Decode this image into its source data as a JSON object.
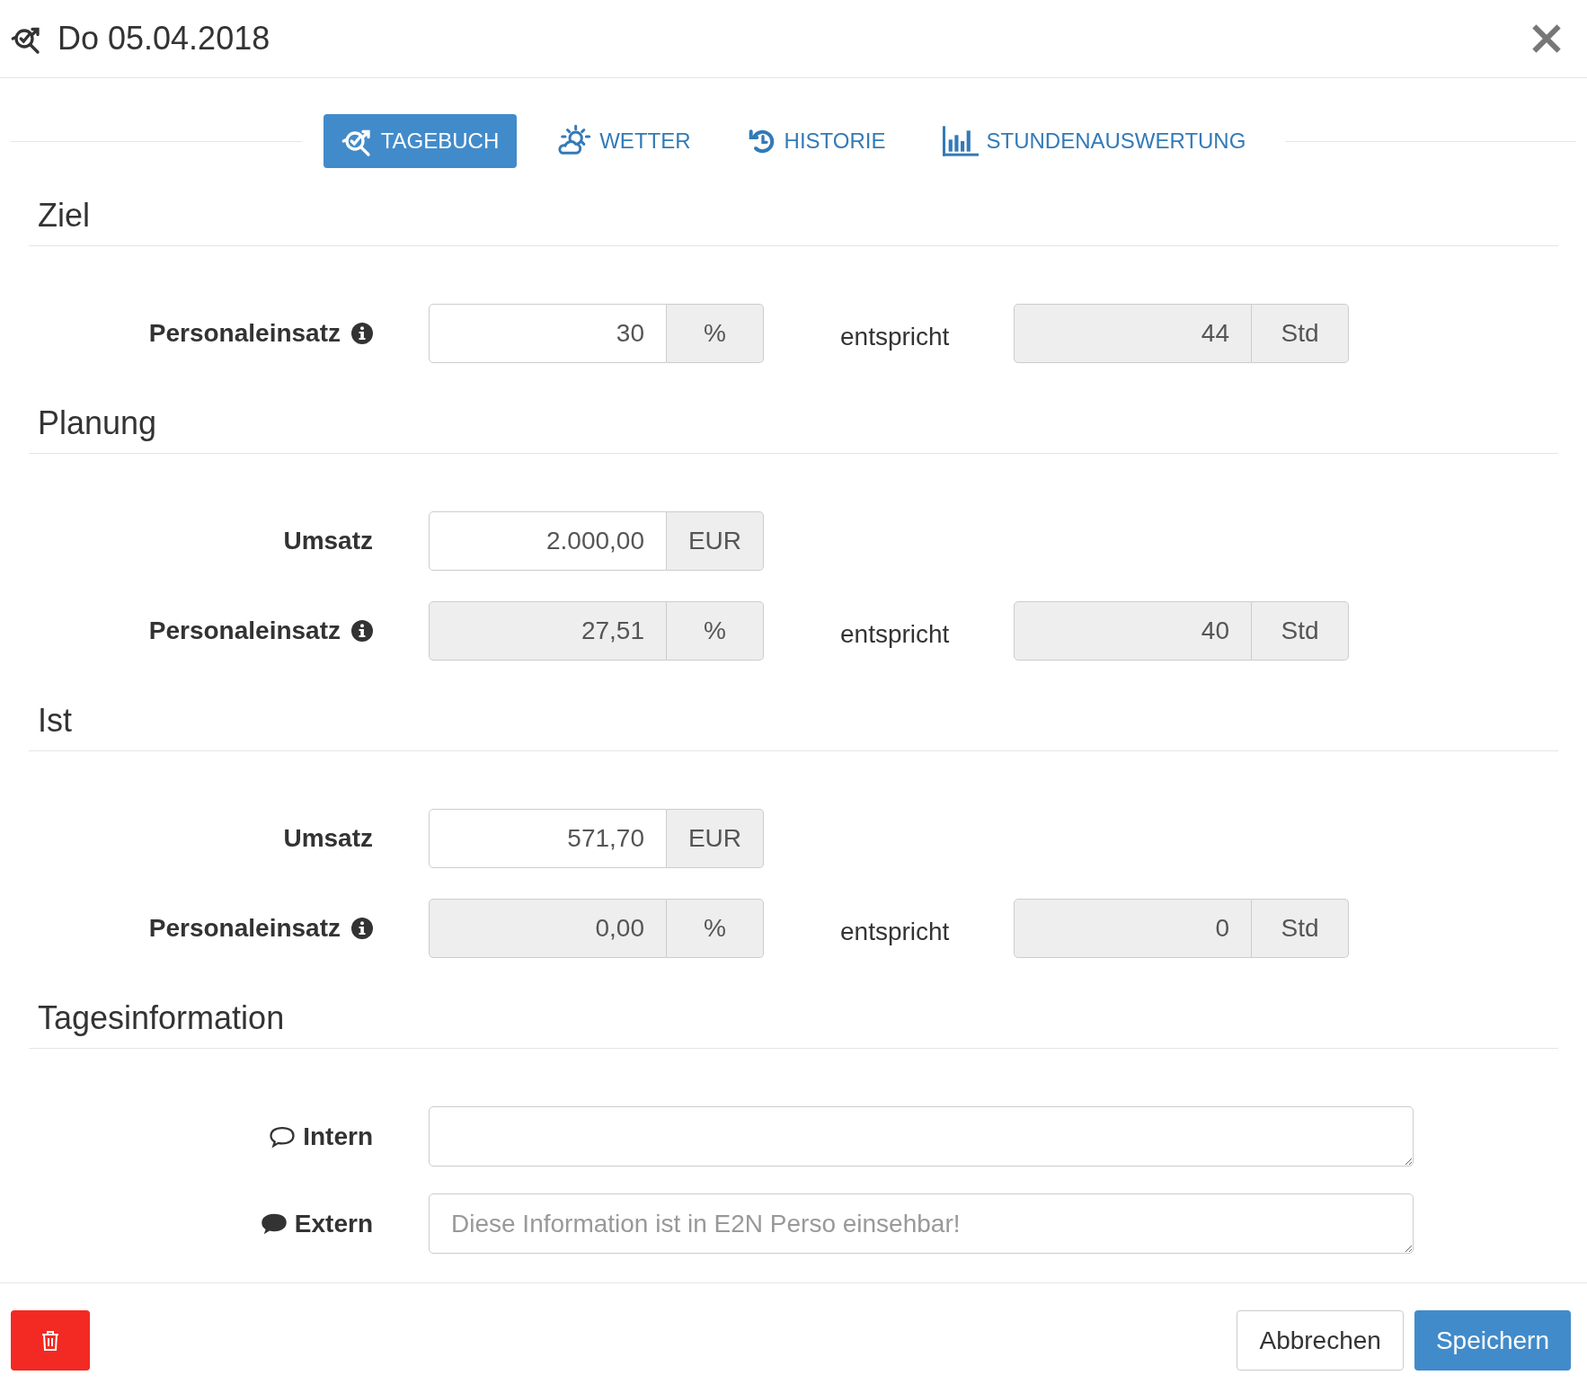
{
  "window": {
    "title": "Do 05.04.2018"
  },
  "tabs": [
    {
      "label": "TAGEBUCH",
      "kind": "diary",
      "selected": true
    },
    {
      "label": "WETTER",
      "kind": "weather",
      "selected": false
    },
    {
      "label": "HISTORIE",
      "kind": "history",
      "selected": false
    },
    {
      "label": "STUNDENAUSWERTUNG",
      "kind": "chart",
      "selected": false
    }
  ],
  "sections": [
    {
      "title": "Ziel",
      "rows": [
        {
          "label": "Personaleinsatz",
          "info": true,
          "value": "30",
          "unit": "%",
          "disabled": false,
          "equivalent": {
            "label": "entspricht",
            "value": "44",
            "unit": "Std",
            "disabled": true
          }
        }
      ]
    },
    {
      "title": "Planung",
      "rows": [
        {
          "label": "Umsatz",
          "info": false,
          "value": "2.000,00",
          "unit": "EUR",
          "disabled": false
        },
        {
          "label": "Personaleinsatz",
          "info": true,
          "value": "27,51",
          "unit": "%",
          "disabled": true,
          "equivalent": {
            "label": "entspricht",
            "value": "40",
            "unit": "Std",
            "disabled": true
          }
        }
      ]
    },
    {
      "title": "Ist",
      "rows": [
        {
          "label": "Umsatz",
          "info": false,
          "value": "571,70",
          "unit": "EUR",
          "disabled": false
        },
        {
          "label": "Personaleinsatz",
          "info": true,
          "value": "0,00",
          "unit": "%",
          "disabled": true,
          "equivalent": {
            "label": "entspricht",
            "value": "0",
            "unit": "Std",
            "disabled": true
          }
        }
      ]
    }
  ],
  "info_section": {
    "title": "Tagesinformation",
    "notes": [
      {
        "label": "Intern",
        "kind": "outline"
      },
      {
        "label": "Extern",
        "kind": "filled",
        "placeholder": "Diese Information ist in E2N Perso einsehbar!"
      }
    ]
  },
  "footer": {
    "cancel": "Abbrechen",
    "save": "Speichern"
  }
}
